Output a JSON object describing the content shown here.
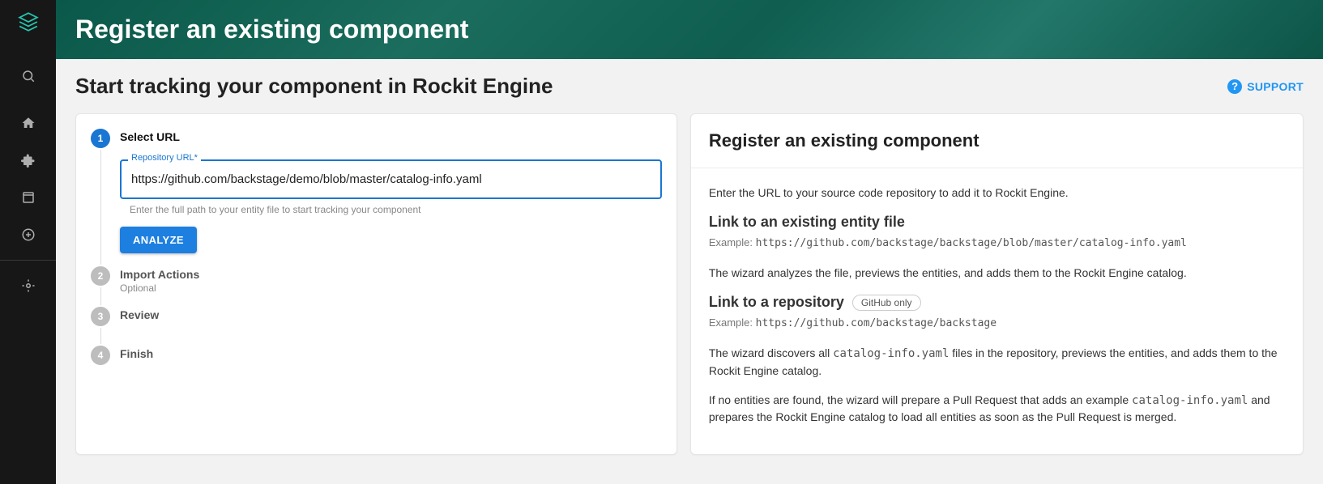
{
  "sidebar": {
    "logo": "logo",
    "items": [
      {
        "name": "search-icon"
      },
      {
        "name": "home-icon"
      },
      {
        "name": "puzzle-icon"
      },
      {
        "name": "library-icon"
      },
      {
        "name": "plus-circle-icon"
      },
      {
        "name": "target-icon"
      }
    ]
  },
  "banner": {
    "title": "Register an existing component"
  },
  "subhead": {
    "title": "Start tracking your component in Rockit Engine",
    "support": "SUPPORT"
  },
  "stepper": {
    "steps": [
      {
        "num": "1",
        "title": "Select URL"
      },
      {
        "num": "2",
        "title": "Import Actions",
        "sub": "Optional"
      },
      {
        "num": "3",
        "title": "Review"
      },
      {
        "num": "4",
        "title": "Finish"
      }
    ],
    "field": {
      "label": "Repository URL",
      "required_mark": "*",
      "value": "https://github.com/backstage/demo/blob/master/catalog-info.yaml",
      "helper": "Enter the full path to your entity file to start tracking your component"
    },
    "analyze": "ANALYZE"
  },
  "info": {
    "heading": "Register an existing component",
    "intro": "Enter the URL to your source code repository to add it to Rockit Engine.",
    "sec1": {
      "title": "Link to an existing entity file",
      "example_label": "Example:",
      "example": "https://github.com/backstage/backstage/blob/master/catalog-info.yaml",
      "desc": "The wizard analyzes the file, previews the entities, and adds them to the Rockit Engine catalog."
    },
    "sec2": {
      "title": "Link to a repository",
      "chip": "GitHub only",
      "example_label": "Example:",
      "example": "https://github.com/backstage/backstage",
      "desc_a": "The wizard discovers all ",
      "desc_code": "catalog-info.yaml",
      "desc_b": " files in the repository, previews the entities, and adds them to the Rockit Engine catalog.",
      "desc2_a": "If no entities are found, the wizard will prepare a Pull Request that adds an example ",
      "desc2_code": "catalog-info.yaml",
      "desc2_b": " and prepares the Rockit Engine catalog to load all entities as soon as the Pull Request is merged."
    }
  }
}
